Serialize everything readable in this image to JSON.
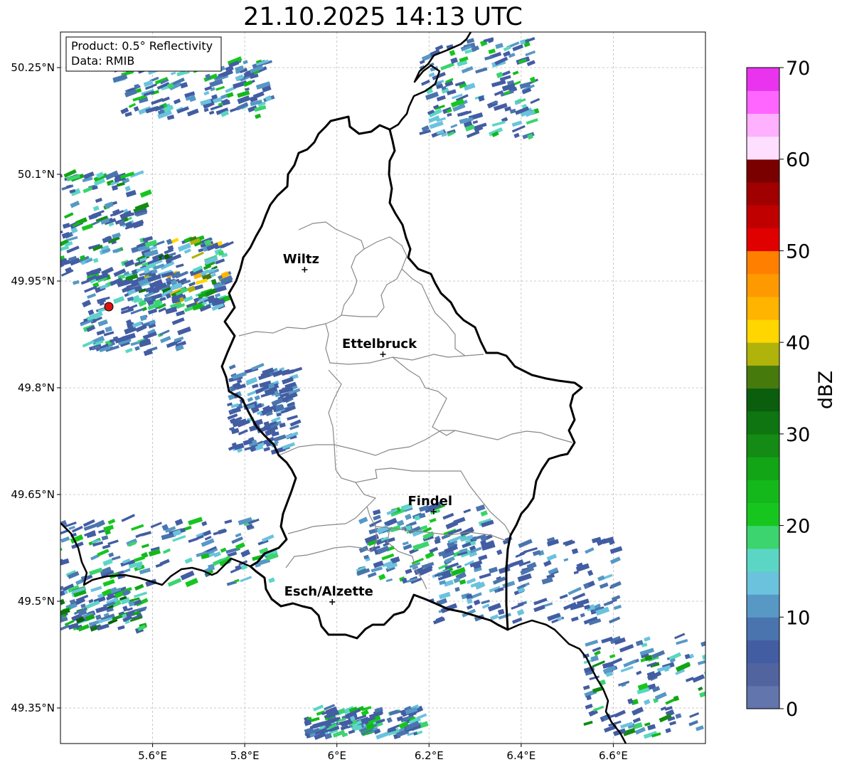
{
  "title": "21.10.2025 14:13 UTC",
  "info_box": {
    "product": "Product: 0.5° Reflectivity",
    "data": "Data: RMIB"
  },
  "axes": {
    "lon_min": 5.4,
    "lon_max": 6.8,
    "lat_min": 49.3,
    "lat_max": 50.3,
    "x_ticks": [
      5.6,
      5.8,
      6.0,
      6.2,
      6.4,
      6.6
    ],
    "x_tick_labels": [
      "5.6°E",
      "5.8°E",
      "6°E",
      "6.2°E",
      "6.4°E",
      "6.6°E"
    ],
    "y_ticks": [
      49.35,
      49.5,
      49.65,
      49.8,
      49.95,
      50.1,
      50.25
    ],
    "y_tick_labels": [
      "49.35°N",
      "49.5°N",
      "49.65°N",
      "49.8°N",
      "49.95°N",
      "50.1°N",
      "50.25°N"
    ],
    "grid": true
  },
  "cities": [
    {
      "name": "Wiltz",
      "lon": 5.93,
      "lat": 49.966
    },
    {
      "name": "Ettelbruck",
      "lon": 6.1,
      "lat": 49.847
    },
    {
      "name": "Findel",
      "lon": 6.21,
      "lat": 49.626
    },
    {
      "name": "Esch/Alzette",
      "lon": 5.99,
      "lat": 49.499
    }
  ],
  "radar_site": {
    "lon": 5.505,
    "lat": 49.914,
    "color": "#dd1111"
  },
  "colorbar": {
    "label": "dBZ",
    "min": 0,
    "max": 70,
    "tick_values": [
      0,
      10,
      20,
      30,
      40,
      50,
      60,
      70
    ],
    "tick_labels": [
      "0",
      "10",
      "20",
      "30",
      "40",
      "50",
      "60",
      "70"
    ],
    "colors": [
      "#6275ac",
      "#52649f",
      "#435da3",
      "#4a74ad",
      "#5798c5",
      "#6bc2dd",
      "#5cd6c4",
      "#3bd46e",
      "#16c61f",
      "#14b81b",
      "#12a515",
      "#138b14",
      "#0e7511",
      "#0b5e0e",
      "#477a0d",
      "#afb30a",
      "#ffd600",
      "#ffb400",
      "#ff9900",
      "#ff7f00",
      "#e10000",
      "#c00000",
      "#a10000",
      "#7a0000",
      "#ffdfff",
      "#ffb0ff",
      "#ff66ff",
      "#e933ee"
    ]
  },
  "chart_data": {
    "type": "heatmap",
    "title": "21.10.2025 14:13 UTC",
    "xlabel": "",
    "ylabel": "",
    "xlim": [
      5.4,
      6.8
    ],
    "ylim": [
      49.3,
      50.3
    ],
    "value_label": "dBZ",
    "value_range": [
      0,
      70
    ],
    "echo_regions": [
      {
        "lon": 5.68,
        "lat": 50.22,
        "dbz_range": [
          5,
          25
        ]
      },
      {
        "lon": 5.48,
        "lat": 50.02,
        "dbz_range": [
          5,
          30
        ]
      },
      {
        "lon": 5.66,
        "lat": 49.96,
        "dbz_range": [
          5,
          45
        ]
      },
      {
        "lon": 5.55,
        "lat": 49.91,
        "dbz_range": [
          5,
          20
        ]
      },
      {
        "lon": 5.62,
        "lat": 49.57,
        "dbz_range": [
          5,
          25
        ]
      },
      {
        "lon": 5.45,
        "lat": 49.49,
        "dbz_range": [
          5,
          35
        ]
      },
      {
        "lon": 5.83,
        "lat": 49.77,
        "dbz_range": [
          5,
          15
        ]
      },
      {
        "lon": 6.3,
        "lat": 50.22,
        "dbz_range": [
          5,
          25
        ]
      },
      {
        "lon": 6.18,
        "lat": 49.58,
        "dbz_range": [
          5,
          25
        ]
      },
      {
        "lon": 6.4,
        "lat": 49.53,
        "dbz_range": [
          5,
          15
        ]
      },
      {
        "lon": 6.7,
        "lat": 49.38,
        "dbz_range": [
          5,
          30
        ]
      },
      {
        "lon": 6.05,
        "lat": 49.33,
        "dbz_range": [
          5,
          25
        ]
      }
    ]
  }
}
